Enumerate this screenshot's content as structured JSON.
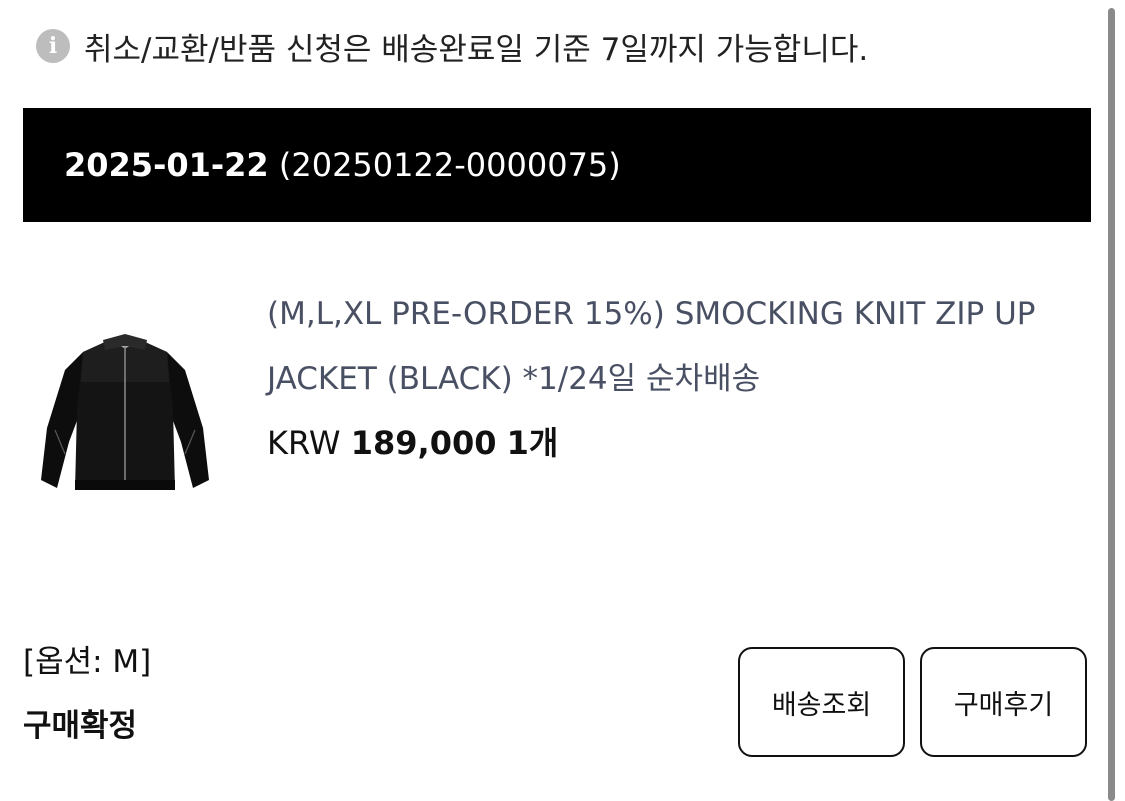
{
  "notice": {
    "icon": "info-icon",
    "text": "취소/교환/반품 신청은 배송완료일 기준 7일까지 가능합니다."
  },
  "order": {
    "date": "2025-01-22",
    "number": "(20250122-0000075)"
  },
  "product": {
    "image_alt": "black zip up jacket",
    "name": "(M,L,XL PRE-ORDER 15%) SMOCKING KNIT ZIP UP JACKET (BLACK) *1/24일 순차배송",
    "currency": "KRW",
    "amount": "189,000",
    "quantity": "1개"
  },
  "option": "[옵션: M]",
  "status": "구매확정",
  "actions": {
    "delivery_label": "배송조회",
    "review_label": "구매후기"
  }
}
